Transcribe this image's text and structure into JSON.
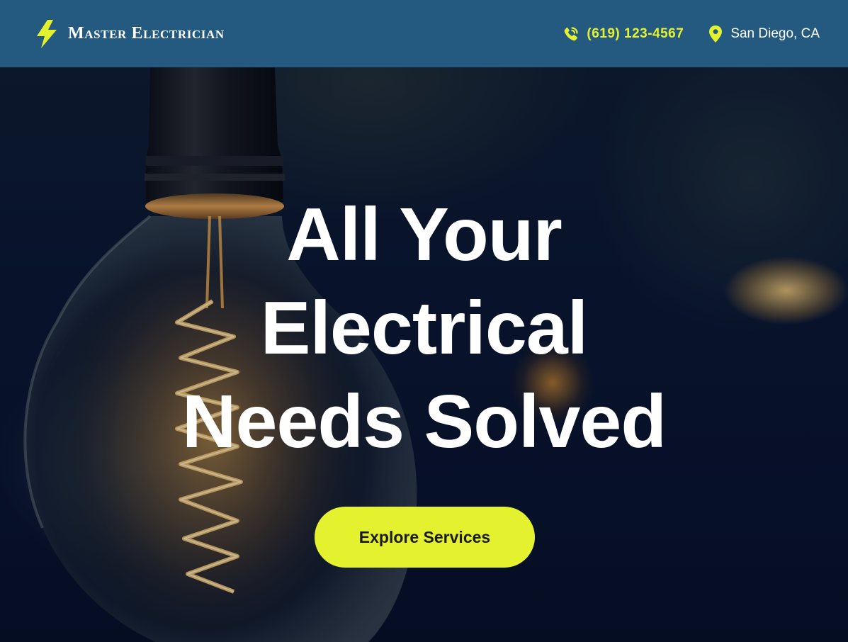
{
  "header": {
    "brand_name": "Master Electrician",
    "brand_icon": "lightning-bolt-icon",
    "phone": "(619) 123-4567",
    "phone_icon": "phone-icon",
    "location": "San Diego, CA",
    "location_icon": "map-pin-icon"
  },
  "hero": {
    "title_line1": "All Your",
    "title_line2": "Electrical",
    "title_line3": "Needs Solved",
    "cta_label": "Explore Services",
    "background_image": "edison-bulb-photo"
  },
  "colors": {
    "header_bg": "#245a80",
    "accent": "#e4f12f",
    "hero_text": "#ffffff"
  }
}
